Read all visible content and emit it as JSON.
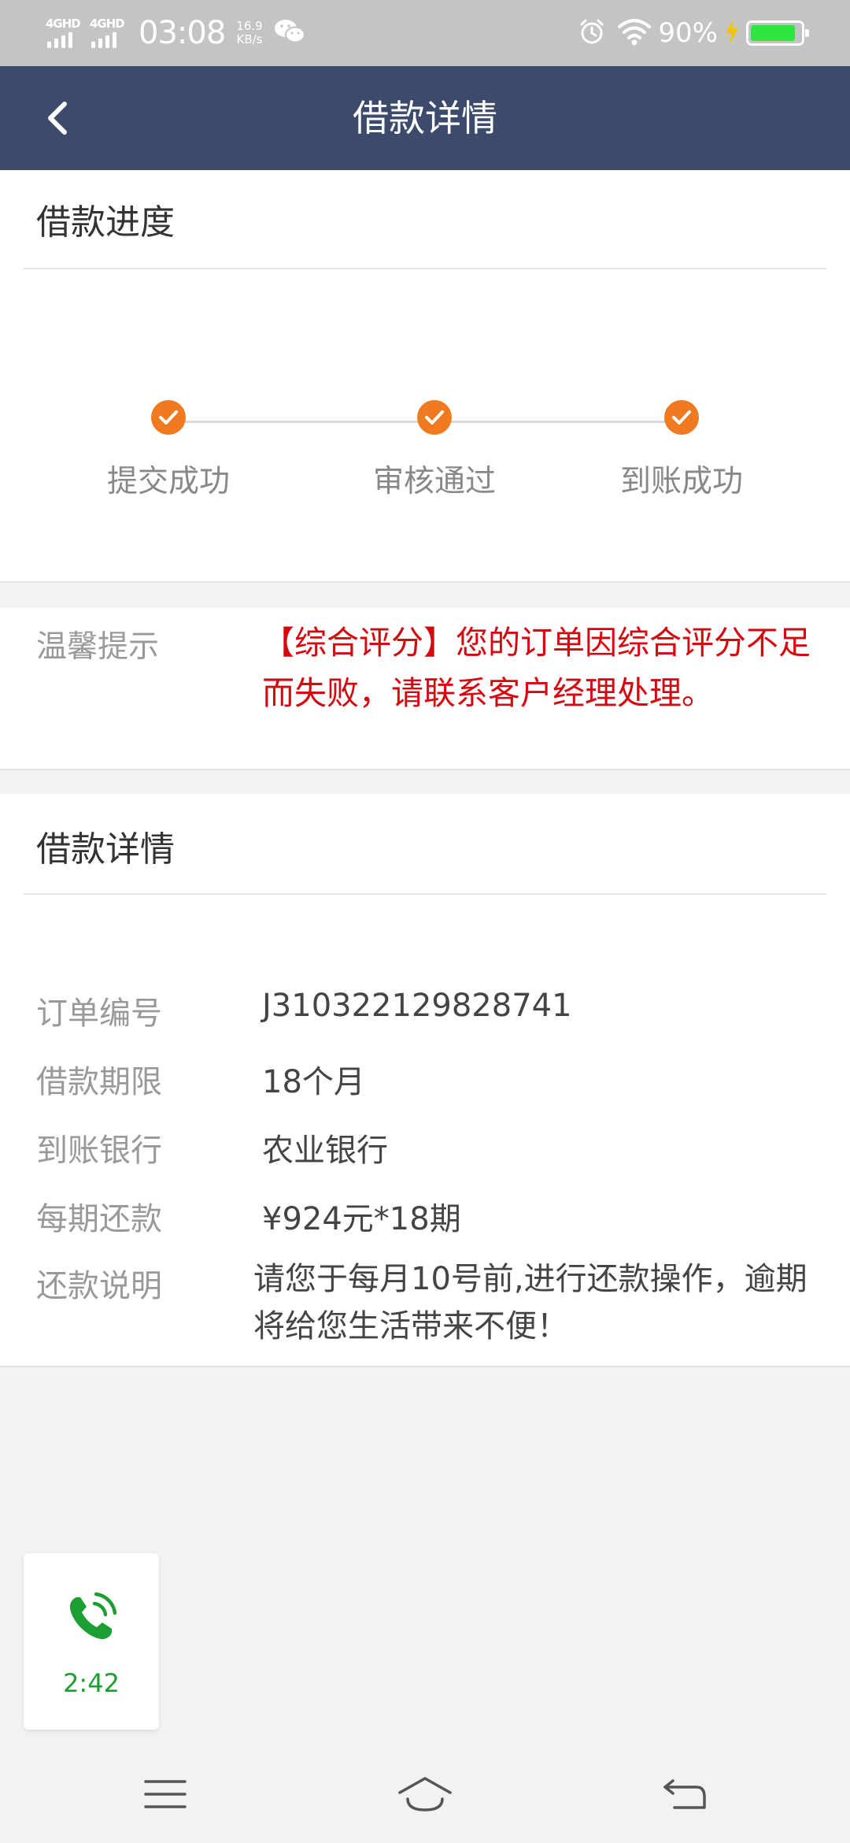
{
  "status_bar": {
    "signal1_label": "4GHD",
    "signal2_label": "4GHD",
    "time": "03:08",
    "speed_value": "16.9",
    "speed_unit": "KB/s",
    "battery_percent": "90%",
    "battery_level": 0.9
  },
  "header": {
    "title": "借款详情"
  },
  "progress": {
    "title": "借款进度",
    "steps": [
      {
        "label": "提交成功",
        "done": true
      },
      {
        "label": "审核通过",
        "done": true
      },
      {
        "label": "到账成功",
        "done": true
      }
    ],
    "accent_color": "#f07a1f"
  },
  "tip": {
    "label": "温馨提示",
    "message": "【综合评分】您的订单因综合评分不足而失败，请联系客户经理处理。",
    "color": "#d4080f"
  },
  "details": {
    "title": "借款详情",
    "rows": [
      {
        "label": "订单编号",
        "value": "J310322129828741"
      },
      {
        "label": "借款期限",
        "value": "18个月"
      },
      {
        "label": "到账银行",
        "value": "农业银行"
      },
      {
        "label": "每期还款",
        "value": "¥924元*18期"
      },
      {
        "label": "还款说明",
        "value": "请您于每月10号前,进行还款操作，逾期将给您生活带来不便！"
      }
    ]
  },
  "call": {
    "duration": "2:42",
    "icon": "phone-call-icon",
    "color": "#1c9e33"
  },
  "nav": {
    "menu_icon": "menu-icon",
    "home_icon": "home-icon",
    "back_icon": "back-icon"
  },
  "colors": {
    "header_bg": "#3c4b6c",
    "status_bar_bg": "#c4c4c4",
    "page_bg": "#f2f2f2"
  }
}
